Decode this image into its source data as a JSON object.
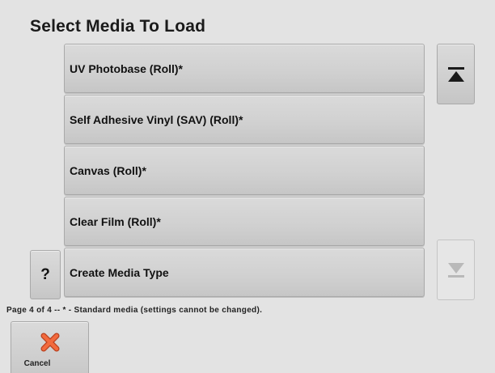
{
  "title": "Select Media To Load",
  "media_items": [
    {
      "label": "UV Photobase (Roll)*"
    },
    {
      "label": "Self Adhesive Vinyl (SAV) (Roll)*"
    },
    {
      "label": "Canvas (Roll)*"
    },
    {
      "label": "Clear Film (Roll)*"
    },
    {
      "label": "Create Media Type"
    }
  ],
  "help_label": "?",
  "scroll_top": {
    "icon": "scroll-to-top-icon",
    "enabled": true
  },
  "scroll_down": {
    "icon": "scroll-down-icon",
    "enabled": false
  },
  "footer_note": "Page 4 of 4 -- * - Standard media (settings cannot be changed).",
  "cancel": {
    "label": "Cancel",
    "icon": "cancel-x-icon",
    "icon_color": "#e4572e"
  },
  "colors": {
    "background": "#e3e3e3",
    "button": "#d0d0d0",
    "icon_dark": "#1a1a1a",
    "icon_disabled": "#b9b9b9"
  }
}
